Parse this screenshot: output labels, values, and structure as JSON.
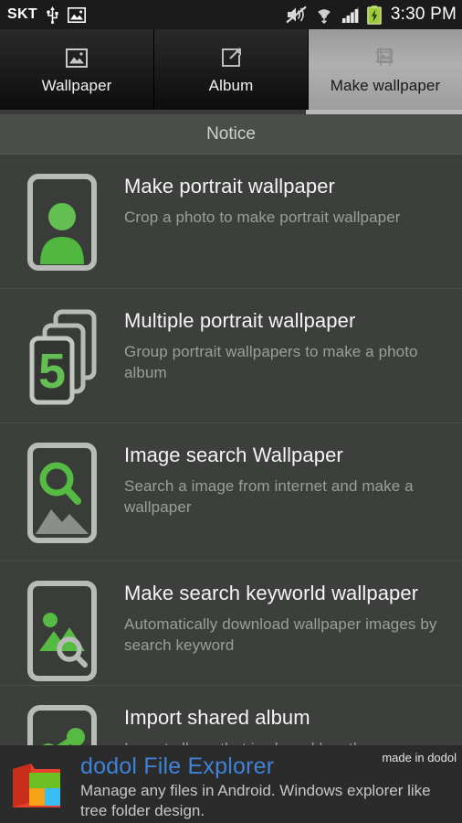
{
  "statusbar": {
    "carrier": "SKT",
    "time": "3:30 PM",
    "icons": [
      "usb-icon",
      "screenshot-image-icon",
      "sound-muted-icon",
      "wifi-icon",
      "cell-signal-icon",
      "battery-charging-icon"
    ]
  },
  "tabs": [
    {
      "label": "Wallpaper",
      "icon": "image-frame-icon",
      "active": false
    },
    {
      "label": "Album",
      "icon": "share-export-icon",
      "active": false
    },
    {
      "label": "Make wallpaper",
      "icon": "crop-image-icon",
      "active": true
    }
  ],
  "notice": {
    "label": "Notice"
  },
  "list": {
    "items": [
      {
        "title": "Make portrait wallpaper",
        "desc": "Crop a photo to make portrait wallpaper",
        "icon": "person-portrait-icon"
      },
      {
        "title": "Multiple portrait wallpaper",
        "desc": "Group portrait wallpapers to make a photo album",
        "icon": "card-stack-five-icon",
        "badge": "5"
      },
      {
        "title": "Image search Wallpaper",
        "desc": "Search a image from internet and make a wallpaper",
        "icon": "magnifier-mountain-icon"
      },
      {
        "title": "Make search keyworld wallpaper",
        "desc": "Automatically download wallpaper images by search keyword",
        "icon": "photo-search-icon"
      },
      {
        "title": "Import shared album",
        "desc": "Import album that is shared by other",
        "icon": "share-nodes-icon"
      }
    ]
  },
  "ad": {
    "title": "dodol File Explorer",
    "desc": "Manage any files in Android. Windows explorer like tree folder design.",
    "made_in": "made in dodol",
    "icon": "colored-folder-icon",
    "title_color": "#3f83d8"
  },
  "colors": {
    "accent_green": "#5cb85c",
    "page_bg": "#3d3f3d",
    "notice_bg": "#4b4d4b",
    "statusbar_bg": "#1b1b1b",
    "ad_bg": "#2b2b2b"
  }
}
